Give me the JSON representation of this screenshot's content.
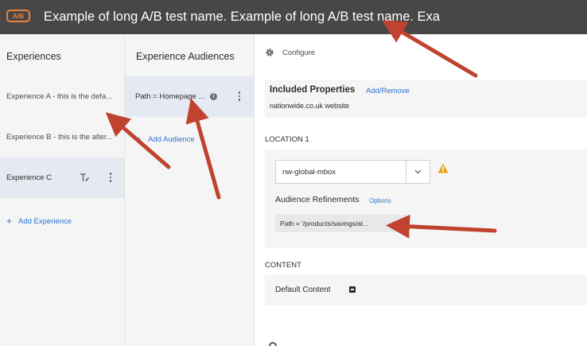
{
  "header": {
    "badge": "A/B",
    "title": "Example of long A/B test name. Example of long A/B test name. Exa"
  },
  "experiences": {
    "title": "Experiences",
    "items": [
      {
        "label": "Experience A - this is the defa..."
      },
      {
        "label": "Experience B - this is the alter..."
      },
      {
        "label": "Experience C"
      }
    ],
    "add_label": "Add Experience"
  },
  "audiences": {
    "title": "Experience Audiences",
    "items": [
      {
        "label": "Path = Homepage ..."
      }
    ],
    "add_label": "Add Audience"
  },
  "configure": {
    "label": "Configure",
    "included_properties": {
      "title": "Included Properties",
      "action": "Add/Remove",
      "value": "nationwide.co.uk website"
    },
    "location": {
      "label": "LOCATION 1",
      "mbox": "nw-global-mbox",
      "refinements_label": "Audience Refinements",
      "options_label": "Options",
      "refinement": "Path = '/products/savings/al..."
    },
    "content": {
      "label": "CONTENT",
      "default_content": "Default Content"
    }
  },
  "colors": {
    "header_bg": "#474747",
    "badge": "#e8833a",
    "link": "#2d72d2",
    "selected_bg": "#e5e9f2",
    "annotation_arrow": "#c0432f",
    "warning": "#e8a317"
  }
}
